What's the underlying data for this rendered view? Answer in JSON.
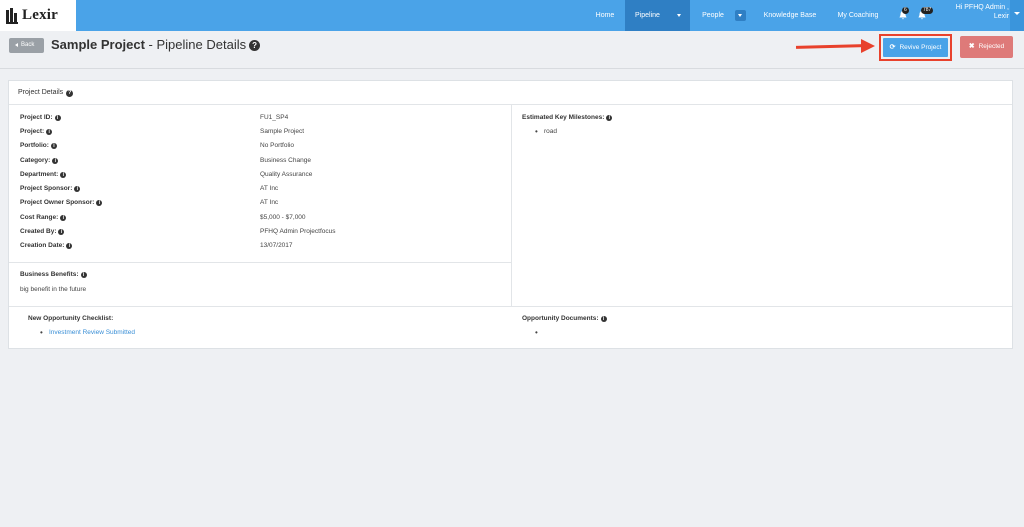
{
  "brand": {
    "name": "Lexir"
  },
  "nav": {
    "home": "Home",
    "pipeline": "Pipeline",
    "people": "People",
    "knowledge_base": "Knowledge Base",
    "my_coaching": "My Coaching",
    "notif_count_1": "6",
    "notif_count_2": "787",
    "user_line1": "Hi PFHQ Admin ,",
    "user_line2": "Lexir"
  },
  "header": {
    "back_label": "Back",
    "title_bold": "Sample Project",
    "title_rest": " - Pipeline Details",
    "help": "?",
    "revive_label": "Revive Project",
    "rejected_label": "Rejected"
  },
  "card": {
    "title": "Project Details",
    "fields": [
      {
        "label": "Project ID:",
        "value": "FU1_SP4"
      },
      {
        "label": "Project:",
        "value": "Sample Project"
      },
      {
        "label": "Portfolio:",
        "value": "No Portfolio"
      },
      {
        "label": "Category:",
        "value": "Business Change"
      },
      {
        "label": "Department:",
        "value": "Quality Assurance"
      },
      {
        "label": "Project Sponsor:",
        "value": "AT Inc"
      },
      {
        "label": "Project Owner Sponsor:",
        "value": "AT Inc"
      },
      {
        "label": "Cost Range:",
        "value": "$5,000 - $7,000"
      },
      {
        "label": "Created By:",
        "value": "PFHQ Admin Projectfocus"
      },
      {
        "label": "Creation Date:",
        "value": "13/07/2017"
      }
    ],
    "milestones_label": "Estimated Key Milestones:",
    "milestones": [
      "road"
    ],
    "benefits_label": "Business Benefits:",
    "benefits_value": "big benefit in the future",
    "checklist_label": "New Opportunity Checklist:",
    "checklist": [
      "Investment Review Submitted"
    ],
    "documents_label": "Opportunity Documents:",
    "documents": [
      ""
    ]
  }
}
